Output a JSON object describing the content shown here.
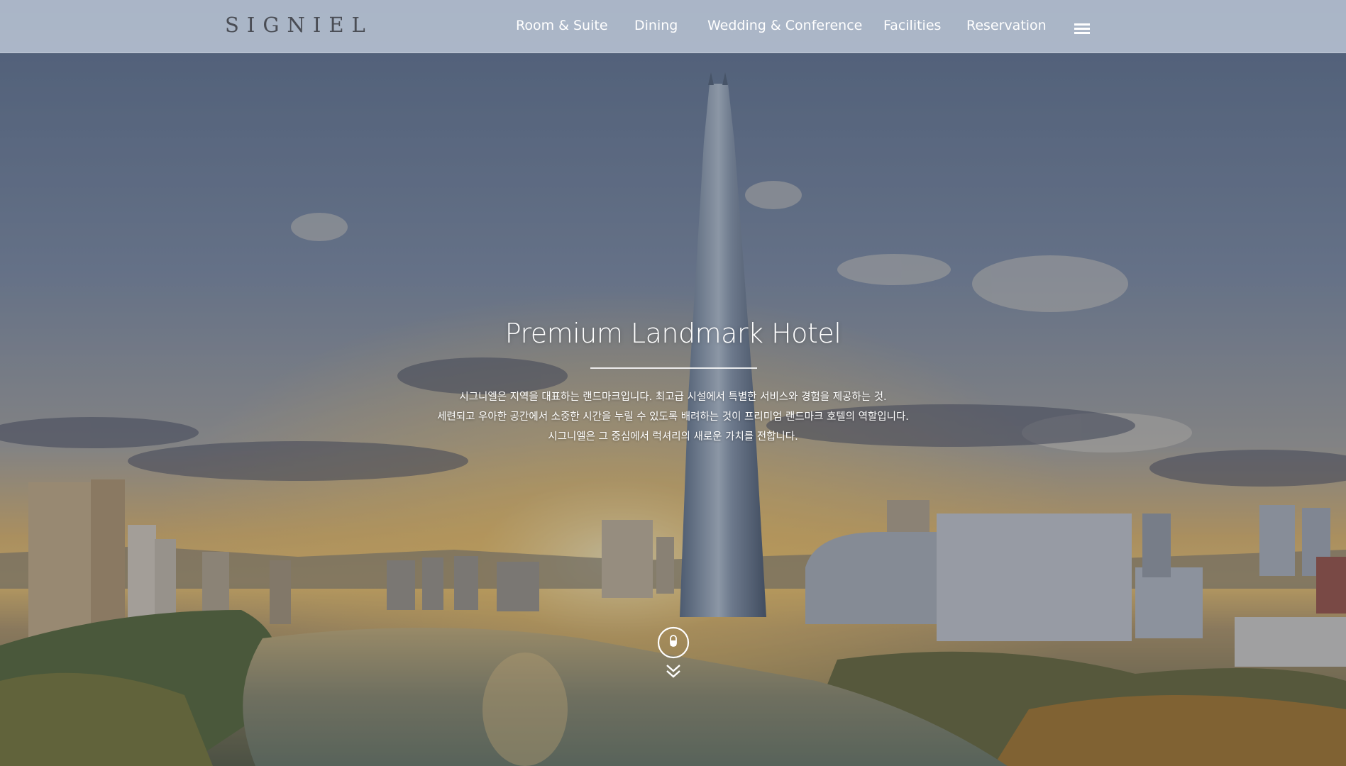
{
  "brand": {
    "logo": "SIGNIEL"
  },
  "nav": {
    "items": [
      {
        "label": "Room & Suite"
      },
      {
        "label": "Dining"
      },
      {
        "label": "Wedding & Conference"
      },
      {
        "label": "Facilities"
      },
      {
        "label": "Reservation"
      }
    ],
    "menu_icon": "hamburger-menu-icon"
  },
  "hero": {
    "title": "Premium Landmark Hotel",
    "description": [
      "시그니엘은 지역을 대표하는 랜드마크입니다. 최고급 시설에서 특별한 서비스와 경험을 제공하는 것.",
      "세련되고 우아한 공간에서 소중한 시간을 누릴 수 있도록 배려하는 것이 프리미엄 랜드마크 호텔의 역할입니다.",
      "시그니엘은 그 중심에서 럭셔리의 새로운 가치를 전합니다."
    ],
    "scroll_icon": "scroll-down-mouse-icon"
  },
  "colors": {
    "header_bg": "#c4cede",
    "logo": "#4a4d55",
    "nav_text": "#ffffff",
    "sky": "#7f8ea6",
    "sunset": "#f0b24a",
    "lake": "#7e8a78"
  }
}
